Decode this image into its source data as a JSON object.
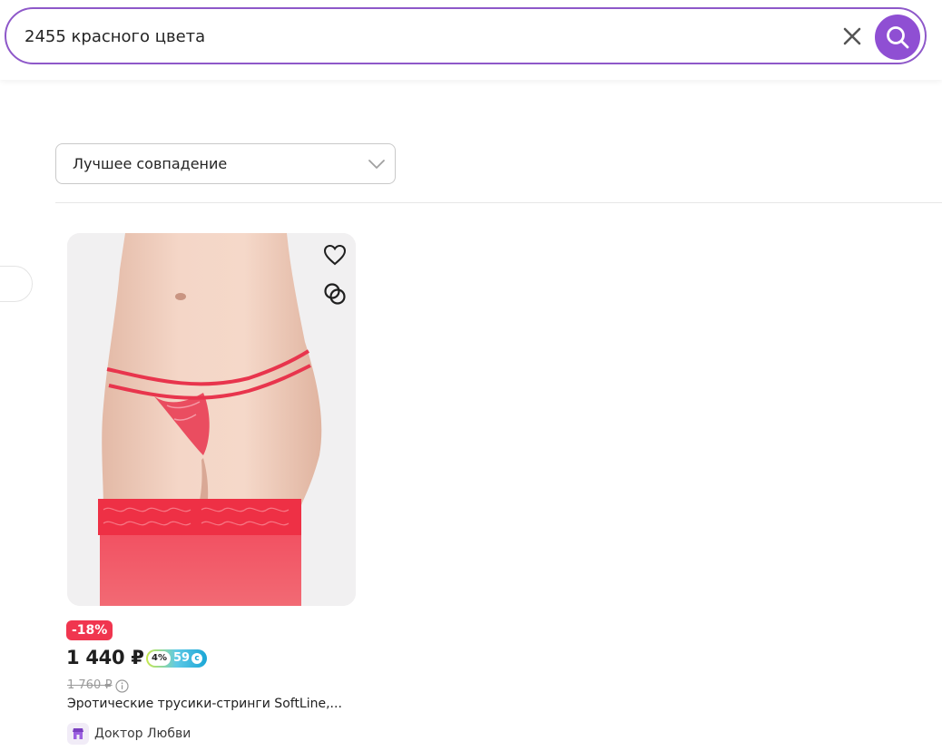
{
  "search": {
    "value": "2455 красного цвета",
    "clear_icon": "close-icon",
    "search_icon": "search-icon"
  },
  "sort": {
    "selected": "Лучшее совпадение",
    "chevron_icon": "chevron-down-icon"
  },
  "product": {
    "discount": "-18%",
    "price": "1 440 ₽",
    "cashback": {
      "percent": "4%",
      "amount": "59"
    },
    "old_price": "1 760 ₽",
    "title": "Эротические трусики-стринги SoftLine,...",
    "seller": "Доктор Любви",
    "favorite_icon": "heart-icon",
    "compare_icon": "compare-icon"
  },
  "colors": {
    "accent": "#8f4fd3",
    "search_border": "#8e58c9",
    "discount": "#f0364f"
  }
}
